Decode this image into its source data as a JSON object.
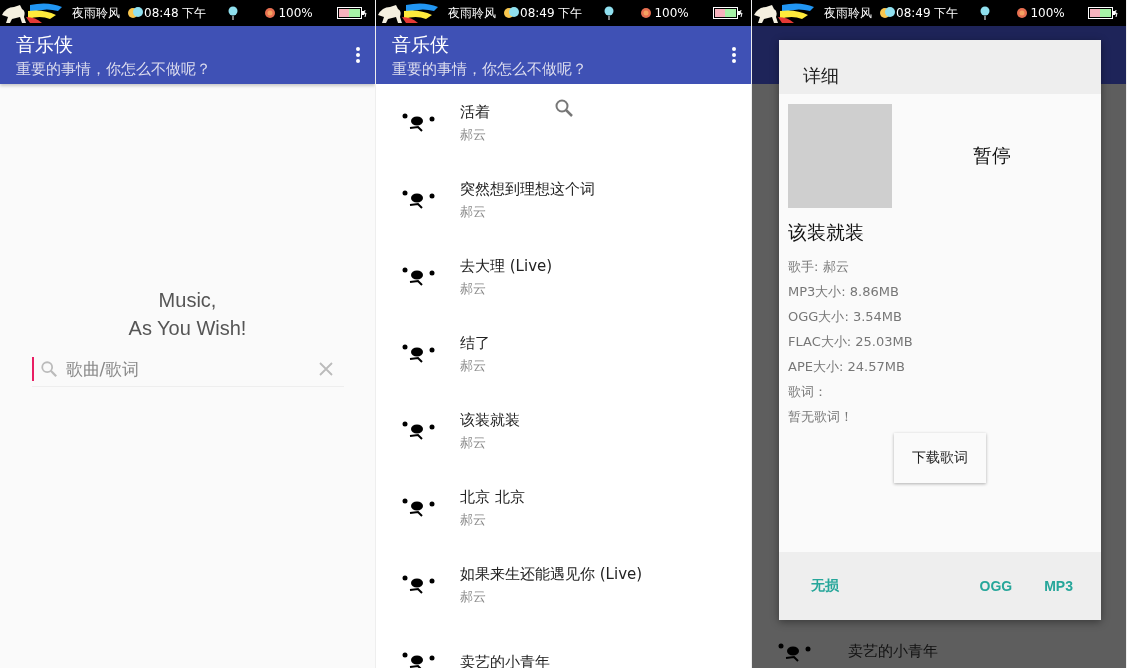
{
  "panels": [
    {
      "kind": "home",
      "status_bar": {
        "carrier": "夜雨聆风",
        "time": "08:48 下午",
        "battery": "100%"
      },
      "app_bar": {
        "title": "音乐侠",
        "subtitle": "重要的事情，你怎么不做呢？"
      },
      "tagline": [
        "Music,",
        "As You Wish!"
      ],
      "search": {
        "placeholder": "歌曲/歌词"
      }
    },
    {
      "kind": "list",
      "status_bar": {
        "carrier": "夜雨聆风",
        "time": "08:49 下午",
        "battery": "100%"
      },
      "app_bar": {
        "title": "音乐侠",
        "subtitle": "重要的事情，你怎么不做呢？"
      },
      "songs": [
        {
          "title": "活着",
          "artist": "郝云"
        },
        {
          "title": "突然想到理想这个词",
          "artist": "郝云"
        },
        {
          "title": "去大理 (Live)",
          "artist": "郝云"
        },
        {
          "title": "结了",
          "artist": "郝云"
        },
        {
          "title": "该装就装",
          "artist": "郝云"
        },
        {
          "title": "北京 北京",
          "artist": "郝云"
        },
        {
          "title": "如果来生还能遇见你 (Live)",
          "artist": "郝云"
        },
        {
          "title": "卖艺的小青年"
        }
      ]
    },
    {
      "kind": "detail",
      "status_bar": {
        "carrier": "夜雨聆风",
        "time": "08:49 下午",
        "battery": "100%"
      },
      "background_song": "卖艺的小青年",
      "dialog": {
        "title": "详细",
        "play_state": "暂停",
        "song": "该装就装",
        "info": [
          "歌手: 郝云",
          "MP3大小: 8.86MB",
          "OGG大小: 3.54MB",
          "FLAC大小: 25.03MB",
          "APE大小: 24.57MB",
          "歌词：",
          "暂无歌词！"
        ],
        "lyrics_button": "下载歌词",
        "actions": [
          "无损",
          "OGG",
          "MP3"
        ]
      }
    }
  ]
}
